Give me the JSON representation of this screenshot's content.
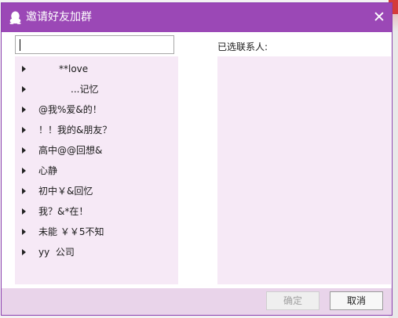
{
  "window": {
    "title": "邀请好友加群",
    "close_glyph": "✕",
    "title_bar_color": "#9b48b6"
  },
  "search": {
    "value": "",
    "placeholder": ""
  },
  "groups": [
    {
      "label": "**love",
      "expanded": false
    },
    {
      "label": "...记忆",
      "expanded": false
    },
    {
      "label": "@我%爱&的！",
      "expanded": false
    },
    {
      "label": "！！我的&朋友？",
      "expanded": false
    },
    {
      "label": "高中@@回想&",
      "expanded": false
    },
    {
      "label": "心静",
      "expanded": false
    },
    {
      "label": "初中￥&回忆",
      "expanded": false
    },
    {
      "label": "我？&*在！",
      "expanded": false
    },
    {
      "label": "未能 ￥￥5不知",
      "expanded": false
    },
    {
      "label": "yy  公司",
      "expanded": false
    }
  ],
  "selected": {
    "label": "已选联系人:",
    "contacts": []
  },
  "footer": {
    "ok_label": "确定",
    "ok_enabled": false,
    "cancel_label": "取消"
  },
  "colors": {
    "panel": "#f6e9f6",
    "footer": "#e9d4ea",
    "border": "#8b3fae"
  },
  "icons": {
    "app": "penguin-icon",
    "close": "close-icon",
    "expand": "expand-arrow-icon"
  }
}
